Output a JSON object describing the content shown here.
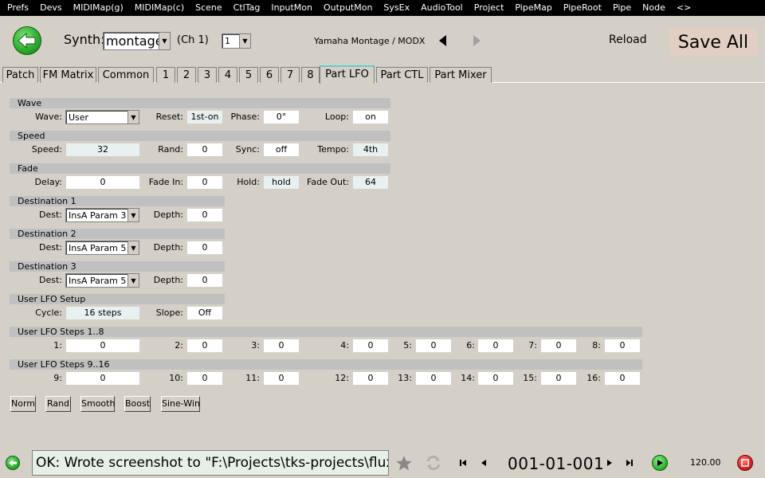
{
  "menu": [
    "Prefs",
    "Devs",
    "MIDIMap(g)",
    "MIDIMap(c)",
    "Scene",
    "CtlTag",
    "InputMon",
    "OutputMon",
    "SysEx",
    "AudioTool",
    "Project",
    "PipeMap",
    "PipeRoot",
    "Pipe",
    "Node",
    "<>"
  ],
  "header": {
    "synth_label": "Synth:",
    "synth_value": "montage",
    "ch_label": "(Ch 1)",
    "ch_value": "1",
    "device_name": "Yamaha Montage / MODX",
    "reload_label": "Reload",
    "save_all_label": "Save All"
  },
  "tabs": [
    {
      "label": "Patch",
      "active": false
    },
    {
      "label": "FM Matrix",
      "active": false
    },
    {
      "label": "Common",
      "active": false
    },
    {
      "label": "1",
      "active": false
    },
    {
      "label": "2",
      "active": false
    },
    {
      "label": "3",
      "active": false
    },
    {
      "label": "4",
      "active": false
    },
    {
      "label": "5",
      "active": false
    },
    {
      "label": "6",
      "active": false
    },
    {
      "label": "7",
      "active": false
    },
    {
      "label": "8",
      "active": false
    },
    {
      "label": "Part LFO",
      "active": true
    },
    {
      "label": "Part CTL",
      "active": false
    },
    {
      "label": "Part Mixer",
      "active": false
    }
  ],
  "wave": {
    "title": "Wave",
    "wave_label": "Wave:",
    "wave_value": "User",
    "reset_label": "Reset:",
    "reset_value": "1st-on",
    "phase_label": "Phase:",
    "phase_value": "0°",
    "loop_label": "Loop:",
    "loop_value": "on"
  },
  "speed": {
    "title": "Speed",
    "speed_label": "Speed:",
    "speed_value": "32",
    "rand_label": "Rand:",
    "rand_value": "0",
    "sync_label": "Sync:",
    "sync_value": "off",
    "tempo_label": "Tempo:",
    "tempo_value": "4th"
  },
  "fade": {
    "title": "Fade",
    "delay_label": "Delay:",
    "delay_value": "0",
    "fadein_label": "Fade In:",
    "fadein_value": "0",
    "hold_label": "Hold:",
    "hold_value": "hold",
    "fadeout_label": "Fade Out:",
    "fadeout_value": "64"
  },
  "dest1": {
    "title": "Destination 1",
    "dest_label": "Dest:",
    "dest_value": "InsA Param 3",
    "depth_label": "Depth:",
    "depth_value": "0"
  },
  "dest2": {
    "title": "Destination 2",
    "dest_label": "Dest:",
    "dest_value": "InsA Param 5",
    "depth_label": "Depth:",
    "depth_value": "0"
  },
  "dest3": {
    "title": "Destination 3",
    "dest_label": "Dest:",
    "dest_value": "InsA Param 5",
    "depth_label": "Depth:",
    "depth_value": "0"
  },
  "user_lfo": {
    "title": "User LFO Setup",
    "cycle_label": "Cycle:",
    "cycle_value": "16 steps",
    "slope_label": "Slope:",
    "slope_value": "Off"
  },
  "steps_1_8": {
    "title": "User LFO Steps 1..8",
    "labels": [
      "1:",
      "2:",
      "3:",
      "4:",
      "5:",
      "6:",
      "7:",
      "8:"
    ],
    "values": [
      "0",
      "0",
      "0",
      "0",
      "0",
      "0",
      "0",
      "0"
    ]
  },
  "steps_9_16": {
    "title": "User LFO Steps 9..16",
    "labels": [
      "9:",
      "10:",
      "11:",
      "12:",
      "13:",
      "14:",
      "15:",
      "16:"
    ],
    "values": [
      "0",
      "0",
      "0",
      "0",
      "0",
      "0",
      "0",
      "0"
    ]
  },
  "actions": [
    "Norm",
    "Rand",
    "Smooth",
    "Boost",
    "Sine-Win"
  ],
  "status": {
    "message": "OK: Wrote screenshot to \"F:\\Projects\\tks-projects\\flux/images/",
    "position": "001-01-001",
    "tempo": "120.00"
  },
  "colors": {
    "background": "#d4d0c8",
    "menubar": "#000000",
    "save_all_bg": "#e2cfc4",
    "back_button": "#2fae2f",
    "play_button": "#33bb33",
    "stop_button": "#dd2222",
    "status_field_bg": "#e6f0e6"
  },
  "icons": {
    "back": "back-arrow-icon",
    "prev": "left-triangle-icon",
    "next": "right-triangle-icon",
    "star": "star-icon",
    "sync": "sync-icon",
    "first": "skip-to-start-icon",
    "prev_step": "step-back-icon",
    "next_step": "step-forward-icon",
    "last": "skip-to-end-icon",
    "play": "play-icon",
    "stop": "stop-record-icon"
  }
}
